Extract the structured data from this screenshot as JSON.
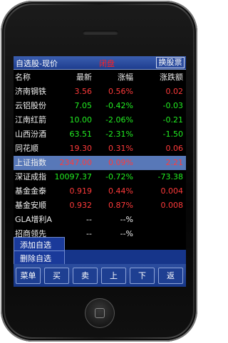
{
  "title": "自选股-现价",
  "status": "闭盘",
  "switch_button": "换股票",
  "columns": [
    "名称",
    "最新",
    "涨幅",
    "涨跌额"
  ],
  "rows": [
    {
      "name": "济南钢铁",
      "price": "3.56",
      "pct": "0.56%",
      "chg": "0.02",
      "color": "red"
    },
    {
      "name": "云铝股份",
      "price": "7.05",
      "pct": "-0.42%",
      "chg": "-0.03",
      "color": "green"
    },
    {
      "name": "江南红箭",
      "price": "10.00",
      "pct": "-2.06%",
      "chg": "-0.21",
      "color": "green"
    },
    {
      "name": "山西汾酒",
      "price": "63.51",
      "pct": "-2.31%",
      "chg": "-1.50",
      "color": "green"
    },
    {
      "name": "同花顺",
      "price": "19.30",
      "pct": "0.31%",
      "chg": "0.06",
      "color": "red"
    },
    {
      "name": "上证指数",
      "price": "2347.00",
      "pct": "0.09%",
      "chg": "2.21",
      "color": "red",
      "selected": true
    },
    {
      "name": "深证成指",
      "price": "10097.37",
      "pct": "-0.72%",
      "chg": "-73.38",
      "color": "green"
    },
    {
      "name": "基金金泰",
      "price": "0.919",
      "pct": "0.44%",
      "chg": "0.004",
      "color": "red"
    },
    {
      "name": "基金安顺",
      "price": "0.932",
      "pct": "0.87%",
      "chg": "0.008",
      "color": "red"
    },
    {
      "name": "GLA增利A",
      "price": "--",
      "pct": "--%",
      "chg": "",
      "color": "white"
    },
    {
      "name": "招商领先",
      "price": "--",
      "pct": "--%",
      "chg": "",
      "color": "white"
    }
  ],
  "popup_menu": [
    "添加自选",
    "删除自选"
  ],
  "bottom_menu": [
    "菜单",
    "买",
    "卖",
    "上",
    "下",
    "返"
  ],
  "colors": {
    "up": "#ff3a3a",
    "down": "#22ee22",
    "selected_row": "#5878b8",
    "bar": "#1e3d8f"
  }
}
